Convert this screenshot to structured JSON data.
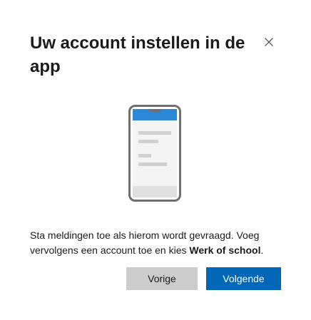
{
  "dialog": {
    "title": "Uw account instellen in de app",
    "close_icon": "close-icon",
    "illustration_icon": "phone-illustration-icon",
    "message_part1": "Sta meldingen toe als hierom wordt gevraagd. Voeg vervolgens een account toe en kies ",
    "message_bold": "Werk of school",
    "message_part2": ".",
    "back_label": "Vorige",
    "next_label": "Volgende"
  },
  "colors": {
    "primary": "#0067b8",
    "secondary_button": "#cccccc",
    "phone_frame": "#6e6e6e",
    "phone_header": "#2b88d8"
  }
}
